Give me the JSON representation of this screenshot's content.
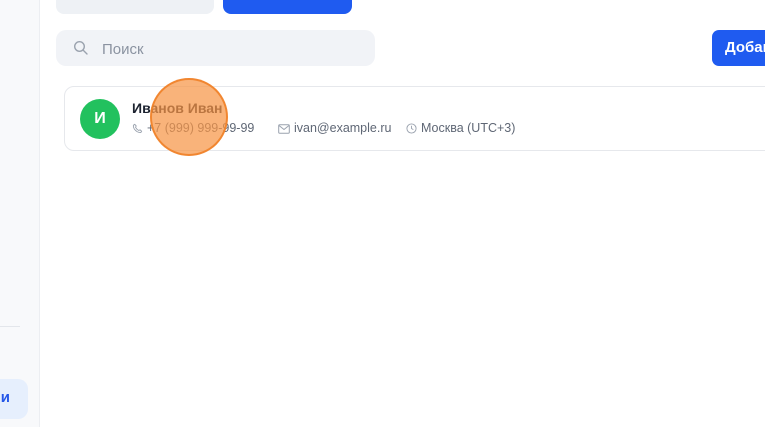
{
  "sidebar": {
    "active_item_label": "и"
  },
  "toolbar": {
    "search_placeholder": "Поиск",
    "add_button_label": "Добав"
  },
  "contacts": [
    {
      "avatar_letter": "И",
      "name": "Иванов Иван",
      "phone": "+7 (999) 999-99-99",
      "email": "ivan@example.ru",
      "timezone": "Москва (UTC+3)"
    }
  ],
  "colors": {
    "accent": "#1f5bf0",
    "avatar": "#22c15e",
    "click_marker": "#f79646"
  }
}
